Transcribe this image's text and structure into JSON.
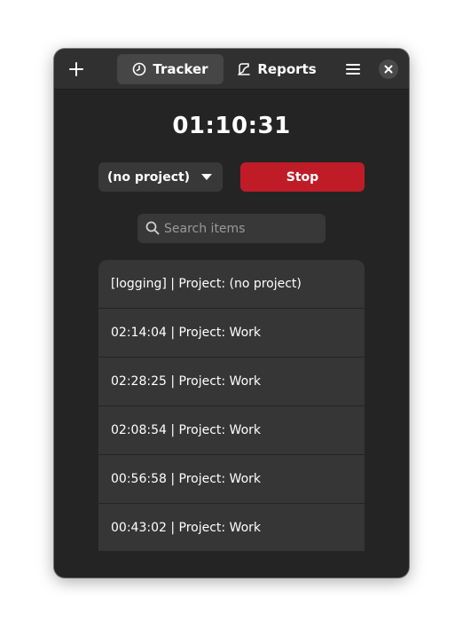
{
  "header": {
    "tabs": [
      {
        "label": "Tracker",
        "icon": "timer-icon",
        "active": true
      },
      {
        "label": "Reports",
        "icon": "report-icon",
        "active": false
      }
    ],
    "add_icon": "plus-icon",
    "menu_icon": "hamburger-menu-icon",
    "close_icon": "close-icon"
  },
  "timer": {
    "value": "01:10:31"
  },
  "project": {
    "selected": "(no project)"
  },
  "stop_button": {
    "label": "Stop",
    "color": "#c01c28"
  },
  "search": {
    "placeholder": "Search items",
    "value": ""
  },
  "items": [
    {
      "label": "[logging] | Project: (no project)"
    },
    {
      "label": "02:14:04 | Project: Work"
    },
    {
      "label": "02:28:25 | Project: Work"
    },
    {
      "label": "02:08:54 | Project: Work"
    },
    {
      "label": "00:56:58 | Project: Work"
    },
    {
      "label": "00:43:02 | Project: Work"
    }
  ]
}
